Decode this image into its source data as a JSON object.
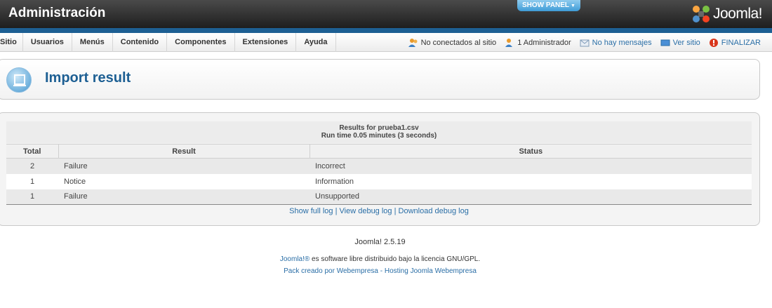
{
  "header": {
    "title": "Administración",
    "show_panel": "SHOW PANEL",
    "logo_text": "Joomla!"
  },
  "menu": {
    "items": [
      "Sitio",
      "Usuarios",
      "Menús",
      "Contenido",
      "Componentes",
      "Extensiones",
      "Ayuda"
    ]
  },
  "status": {
    "not_connected": "No conectados al sitio",
    "admins": "1 Administrador",
    "messages": "No hay mensajes",
    "view_site": "Ver sitio",
    "logout": "FINALIZAR"
  },
  "page": {
    "title": "Import result"
  },
  "results": {
    "heading_line1": "Results for prueba1.csv",
    "heading_line2": "Run time 0.05 minutes (3 seconds)",
    "columns": [
      "Total",
      "Result",
      "Status"
    ],
    "rows": [
      {
        "total": "2",
        "result": "Failure",
        "status": "Incorrect"
      },
      {
        "total": "1",
        "result": "Notice",
        "status": "Information"
      },
      {
        "total": "1",
        "result": "Failure",
        "status": "Unsupported"
      }
    ],
    "links": {
      "show_full_log": "Show full log",
      "view_debug_log": "View debug log",
      "download_debug_log": "Download debug log",
      "separator": " | "
    }
  },
  "footer": {
    "version": "Joomla! 2.5.19",
    "license_link": "Joomla!®",
    "license_text": " es software libre distribuido bajo la licencia GNU/GPL.",
    "pack_text": "Pack creado por ",
    "pack_link": "Webempresa",
    "hosting_sep": " - ",
    "hosting_link": "Hosting Joomla Webempresa"
  },
  "colors": {
    "header_bg": "#1e1e1e",
    "blue_bar": "#1d5f93",
    "link": "#2a6ea6",
    "title": "#1d5f93"
  }
}
